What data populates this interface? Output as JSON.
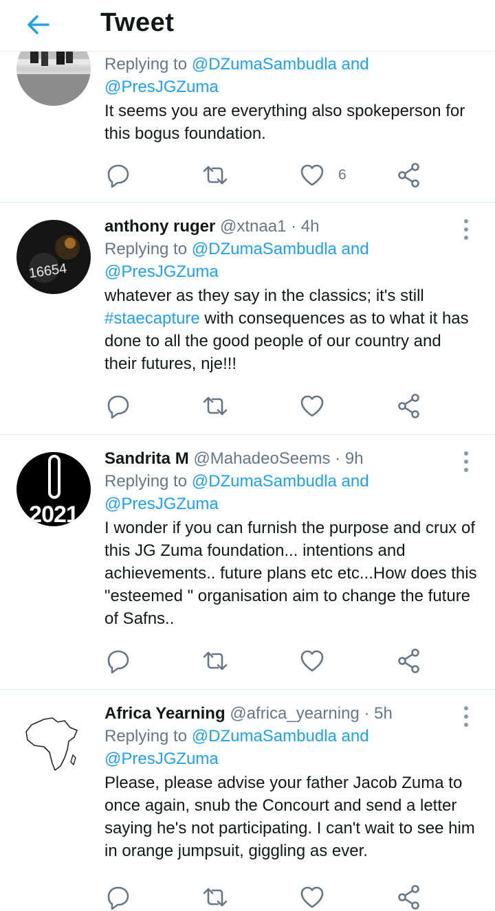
{
  "header": {
    "title": "Tweet",
    "back_icon": "arrow-left-icon"
  },
  "colors": {
    "accent": "#1da1f2",
    "muted": "#657786",
    "text": "#14171a",
    "divider": "#e1e8ed"
  },
  "tweets": [
    {
      "replying_prefix": "Replying to",
      "replying_handle1": "@DZumaSambudla",
      "replying_and": "and",
      "replying_handle2": "@PresJGZuma",
      "text": "It seems you are everything also spokeperson for this bogus foundation.",
      "like_count": "6"
    },
    {
      "name": "anthony ruger",
      "handle": "@xtnaa1",
      "dot": "·",
      "time": "4h",
      "replying_prefix": "Replying to",
      "replying_handle1": "@DZumaSambudla",
      "replying_and": "and",
      "replying_handle2": "@PresJGZuma",
      "text_before": "whatever as they say in the classics; it's still ",
      "hashtag": "#staecapture",
      "text_after": " with consequences as to what it has done to all the good people of our country and their futures, nje!!!",
      "avatar_text": "16654"
    },
    {
      "name": "Sandrita M",
      "handle": "@MahadeoSeems",
      "dot": "·",
      "time": "9h",
      "replying_prefix": "Replying to",
      "replying_handle1": "@DZumaSambudla",
      "replying_and": "and",
      "replying_handle2": "@PresJGZuma",
      "text": "I wonder if you can furnish the purpose and crux of this JG Zuma foundation... intentions and achievements.. future plans etc etc...How does this \"esteemed \" organisation aim to change the future of Safns..",
      "avatar_text": "2021"
    },
    {
      "name": "Africa Yearning",
      "handle": "@africa_yearning",
      "dot": "·",
      "time": "5h",
      "replying_prefix": "Replying to",
      "replying_handle1": "@DZumaSambudla",
      "replying_and": "and",
      "replying_handle2": "@PresJGZuma",
      "text": "Please, please advise your father Jacob Zuma to once again, snub the Concourt and send a letter saying he's not participating. I can't wait to see him in orange jumpsuit, giggling as ever."
    }
  ]
}
